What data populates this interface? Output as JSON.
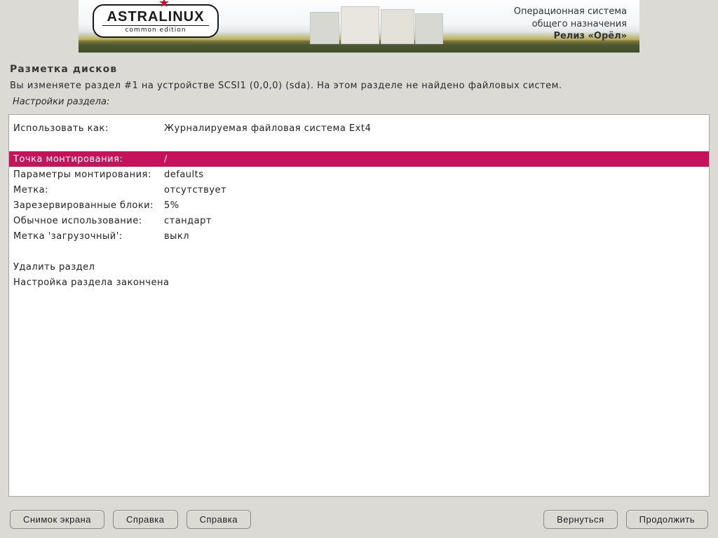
{
  "banner": {
    "logo_title": "ASTRALINUX",
    "logo_sub": "common edition",
    "line1": "Операционная система",
    "line2": "общего назначения",
    "release": "Релиз «Орёл»"
  },
  "page": {
    "title": "Разметка дисков",
    "description": "Вы изменяете раздел #1 на устройстве SCSI1 (0,0,0) (sda). На этом разделе не найдено файловых систем.",
    "subhead": "Настройки раздела:"
  },
  "settings": {
    "use_as": {
      "label": "Использовать как:",
      "value": "Журналируемая файловая система Ext4"
    },
    "mount_point": {
      "label": "Точка монтирования:",
      "value": "/"
    },
    "mount_options": {
      "label": "Параметры монтирования:",
      "value": "defaults"
    },
    "fs_label": {
      "label": "Метка:",
      "value": "отсутствует"
    },
    "reserved_blocks": {
      "label": "Зарезервированные блоки:",
      "value": "5%"
    },
    "typical_usage": {
      "label": "Обычное использование:",
      "value": "стандарт"
    },
    "bootable": {
      "label": "Метка 'загрузочный':",
      "value": "выкл"
    }
  },
  "actions": {
    "delete": "Удалить раздел",
    "done": "Настройка раздела закончена"
  },
  "buttons": {
    "screenshot": "Снимок экрана",
    "help1": "Справка",
    "help2": "Справка",
    "back": "Вернуться",
    "continue": "Продолжить"
  }
}
